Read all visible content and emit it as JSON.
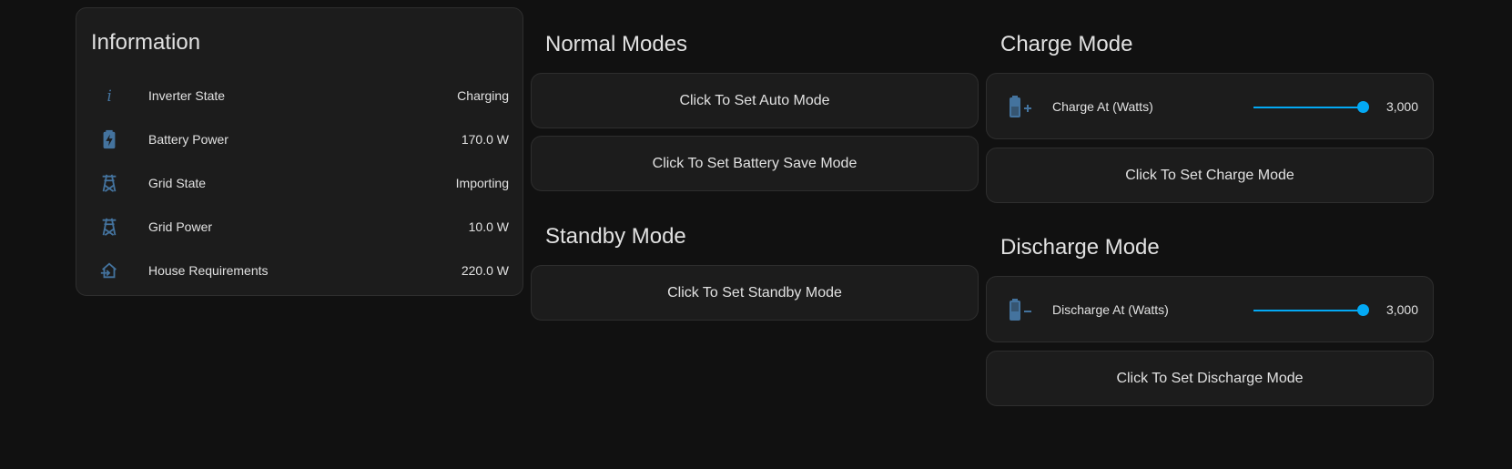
{
  "info": {
    "title": "Information",
    "rows": [
      {
        "icon": "info-icon",
        "label": "Inverter State",
        "value": "Charging"
      },
      {
        "icon": "battery-charging-icon",
        "label": "Battery Power",
        "value": "170.0 W"
      },
      {
        "icon": "transmission-tower-icon",
        "label": "Grid State",
        "value": "Importing"
      },
      {
        "icon": "transmission-tower-icon",
        "label": "Grid Power",
        "value": "10.0 W"
      },
      {
        "icon": "home-import-icon",
        "label": "House Requirements",
        "value": "220.0 W"
      }
    ]
  },
  "normal": {
    "title": "Normal Modes",
    "auto_btn": "Click To Set Auto Mode",
    "battery_save_btn": "Click To Set Battery Save Mode"
  },
  "standby": {
    "title": "Standby Mode",
    "btn": "Click To Set Standby Mode"
  },
  "charge": {
    "title": "Charge Mode",
    "slider_label": "Charge At (Watts)",
    "slider_value": "3,000",
    "btn": "Click To Set Charge Mode"
  },
  "discharge": {
    "title": "Discharge Mode",
    "slider_label": "Discharge At (Watts)",
    "slider_value": "3,000",
    "btn": "Click To Set Discharge Mode"
  },
  "colors": {
    "background": "#111111",
    "card": "#1c1c1c",
    "icon": "#44739e",
    "accent": "#03a9f4"
  }
}
